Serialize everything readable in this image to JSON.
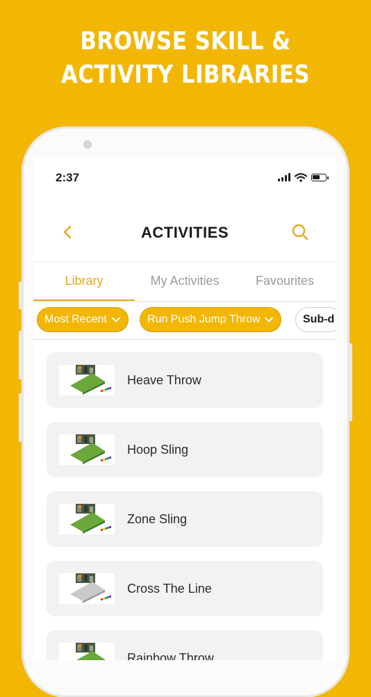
{
  "headline": {
    "line1": "BROWSE SKILL &",
    "line2": "ACTIVITY LIBRARIES"
  },
  "status": {
    "time": "2:37"
  },
  "nav": {
    "title": "ACTIVITIES",
    "back_icon": "chevron-left-icon",
    "search_icon": "search-icon"
  },
  "tabs": [
    {
      "label": "Library",
      "active": true
    },
    {
      "label": "My Activities",
      "active": false
    },
    {
      "label": "Favourites",
      "active": false
    }
  ],
  "filters": [
    {
      "label": "Most Recent",
      "selected": true
    },
    {
      "label": "Run Push Jump Throw",
      "selected": true
    },
    {
      "label": "Sub-d",
      "selected": false
    }
  ],
  "activities": [
    {
      "title": "Heave Throw",
      "mat": "green"
    },
    {
      "title": "Hoop Sling",
      "mat": "green"
    },
    {
      "title": "Zone Sling",
      "mat": "green"
    },
    {
      "title": "Cross The Line",
      "mat": "grey"
    },
    {
      "title": "Rainbow Throw",
      "mat": "green"
    }
  ],
  "colors": {
    "brand_yellow": "#F2B705",
    "accent": "#E8A81E",
    "card_bg": "#f2f2f2"
  }
}
